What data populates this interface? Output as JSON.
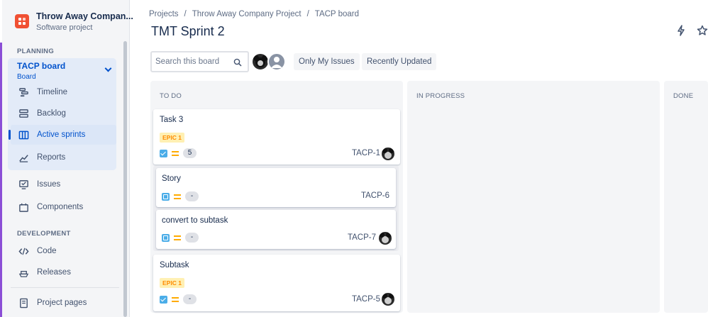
{
  "sidebar": {
    "project_name": "Throw Away Compan...",
    "project_type": "Software project",
    "planning_label": "PLANNING",
    "board": {
      "name": "TACP board",
      "sub": "Board"
    },
    "planning_items": [
      {
        "label": "Timeline",
        "icon": "timeline-icon"
      },
      {
        "label": "Backlog",
        "icon": "backlog-icon"
      },
      {
        "label": "Active sprints",
        "icon": "board-columns-icon"
      },
      {
        "label": "Reports",
        "icon": "reports-chart-icon"
      }
    ],
    "other_items": [
      {
        "label": "Issues",
        "icon": "issues-icon"
      },
      {
        "label": "Components",
        "icon": "components-icon"
      }
    ],
    "development_label": "DEVELOPMENT",
    "dev_items": [
      {
        "label": "Code",
        "icon": "code-icon"
      },
      {
        "label": "Releases",
        "icon": "releases-icon"
      }
    ],
    "project_pages": "Project pages"
  },
  "breadcrumbs": [
    "Projects",
    "Throw Away Company Project",
    "TACP board"
  ],
  "page_title": "TMT Sprint 2",
  "search": {
    "placeholder": "Search this board"
  },
  "filters": {
    "only_my_issues": "Only My Issues",
    "recently_updated": "Recently Updated"
  },
  "columns": {
    "todo": "TO DO",
    "in_progress": "IN PROGRESS",
    "done": "DONE"
  },
  "cards": {
    "task3": {
      "title": "Task 3",
      "epic": "EPIC 1",
      "estimate": "5",
      "key": "TACP-1"
    },
    "story": {
      "title": "Story",
      "estimate": "-",
      "key": "TACP-6"
    },
    "convert": {
      "title": "convert to subtask",
      "estimate": "-",
      "key": "TACP-7"
    },
    "subtask": {
      "title": "Subtask",
      "epic": "EPIC 1",
      "estimate": "-",
      "key": "TACP-5"
    }
  },
  "colors": {
    "accent": "#0052cc",
    "epic_bg": "#fff0b3",
    "epic_text": "#ff8b00",
    "brand": "#f05033"
  }
}
